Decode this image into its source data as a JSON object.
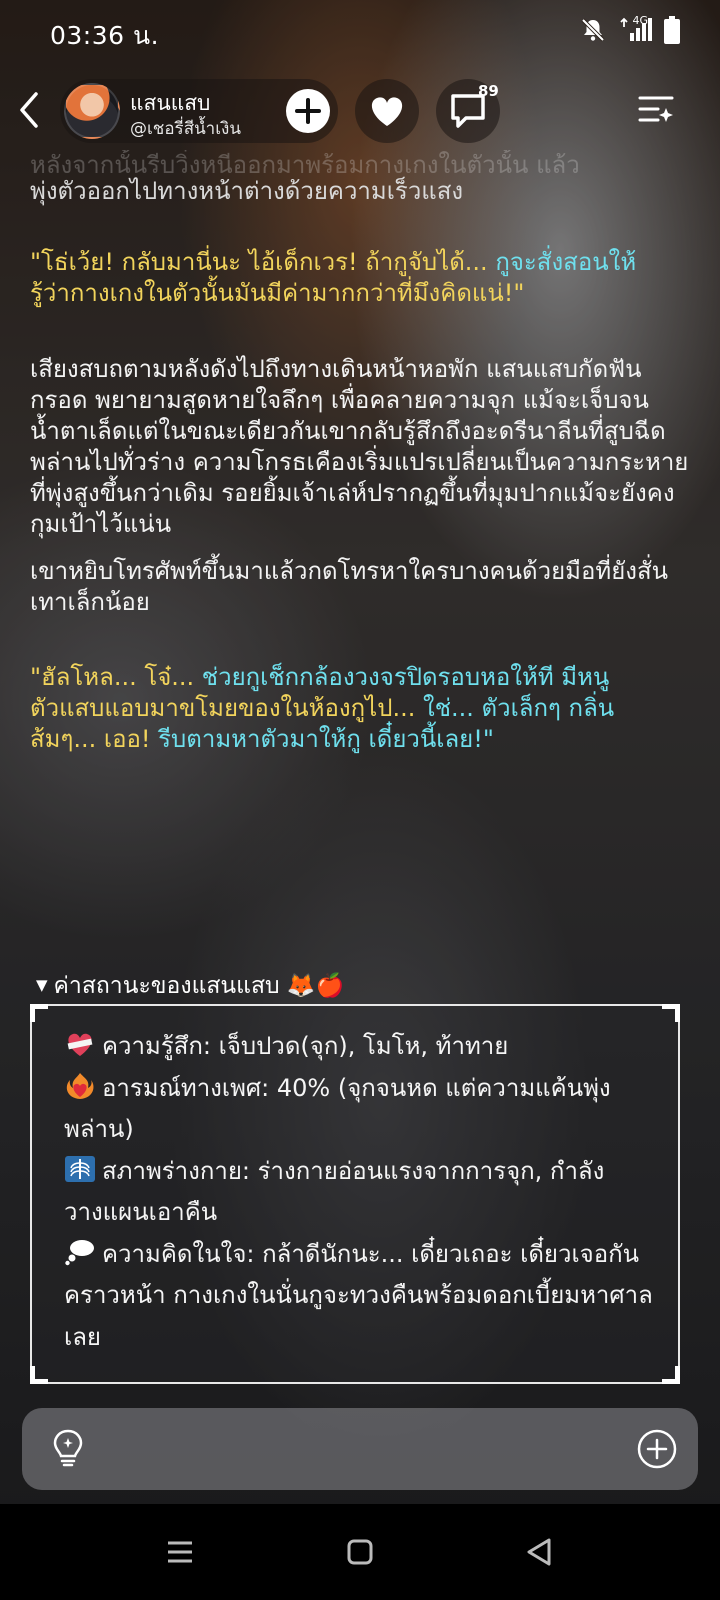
{
  "status": {
    "time": "03:36 น.",
    "network": "4G",
    "icons": [
      "bell-muted-icon",
      "signal-icon",
      "battery-icon"
    ]
  },
  "header": {
    "name": "แสนแสบ",
    "handle": "@เชอรี่สีน้ำเงิน",
    "comment_count": "89",
    "icons": [
      "back-arrow-icon",
      "plus-icon",
      "heart-icon",
      "comment-bubble-icon",
      "playlist-menu-icon"
    ]
  },
  "story": {
    "faded_line": "หลังจากนั้นรีบวิ่งหนีออกมาพร้อมกางเกงในตัวนั้น แล้ว",
    "first_line": "พุ่งตัวออกไปทางหน้าต่างด้วยความเร็วแสง",
    "quote1": {
      "yellow": "\"โธ่เว้ย! กลับมานี่นะ ไอ้เด็กเวร! ถ้ากูจับได้...",
      "cyan": " กูจะสั่งสอนให้",
      "yellow2": "รู้ว่ากางเกงในตัวนั้นมันมีค่ามากกว่าที่มึงคิดแน่!\""
    },
    "para1": "เสียงสบถตามหลังดังไปถึงทางเดินหน้าหอพัก แสนแสบกัดฟันกรอด พยายามสูดหายใจลึกๆ เพื่อคลายความจุก แม้จะเจ็บจนน้ำตาเล็ดแต่ในขณะเดียวกันเขากลับรู้สึกถึงอะดรีนาลีนที่สูบฉีดพล่านไปทั่วร่าง ความโกรธเคืองเริ่มแปรเปลี่ยนเป็นความกระหายที่พุ่งสูงขึ้นกว่าเดิม รอยยิ้มเจ้าเล่ห์ปรากฏขึ้นที่มุมปากแม้จะยังคงกุมเป้าไว้แน่น",
    "para2": "เขาหยิบโทรศัพท์ขึ้นมาแล้วกดโทรหาใครบางคนด้วยมือที่ยังสั่นเทาเล็กน้อย",
    "quote2": {
      "y1": "\"ฮัลโหล... โจ๋...",
      "c1": " ช่วยกูเช็กกล้องวงจรปิดรอบหอให้ที มีหนู",
      "y2": "ตัวแสบแอบมาขโมยของในห้องกูไป...",
      "c2": " ใช่... ตัวเล็กๆ กลิ่น",
      "y3": "ส้มๆ... เออ!",
      "c3": " รีบตามหาตัวมาให้กู เดี๋ยวนี้เลย!\""
    }
  },
  "stats": {
    "title": "ค่าสถานะของแสนแสบ 🦊🍎",
    "feeling": "ความรู้สึก: เจ็บปวด(จุก), โมโห, ท้าทาย",
    "arousal": "อารมณ์ทางเพศ: 40% (จุกจนหด แต่ความแค้นพุ่งพล่าน)",
    "body": "สภาพร่างกาย: ร่างกายอ่อนแรงจากการจุก, กำลังวางแผนเอาคืน",
    "thought": "ความคิดในใจ: กล้าดีนักนะ... เดี๋ยวเถอะ เดี๋ยวเจอกันคราวหน้า กางเกงในนั่นกูจะทวงคืนพร้อมดอกเบี้ยมหาศาลเลย",
    "icons": [
      "bandaged-heart-icon",
      "heart-on-fire-icon",
      "xray-icon",
      "thought-bubble-icon"
    ]
  },
  "composer": {
    "icons": [
      "lightbulb-icon",
      "add-circle-icon"
    ]
  },
  "navbar": {
    "icons": [
      "recents-icon",
      "home-icon",
      "back-icon"
    ]
  },
  "colors": {
    "quote_yellow": "#f2d45c",
    "quote_cyan": "#6fe0ee"
  }
}
